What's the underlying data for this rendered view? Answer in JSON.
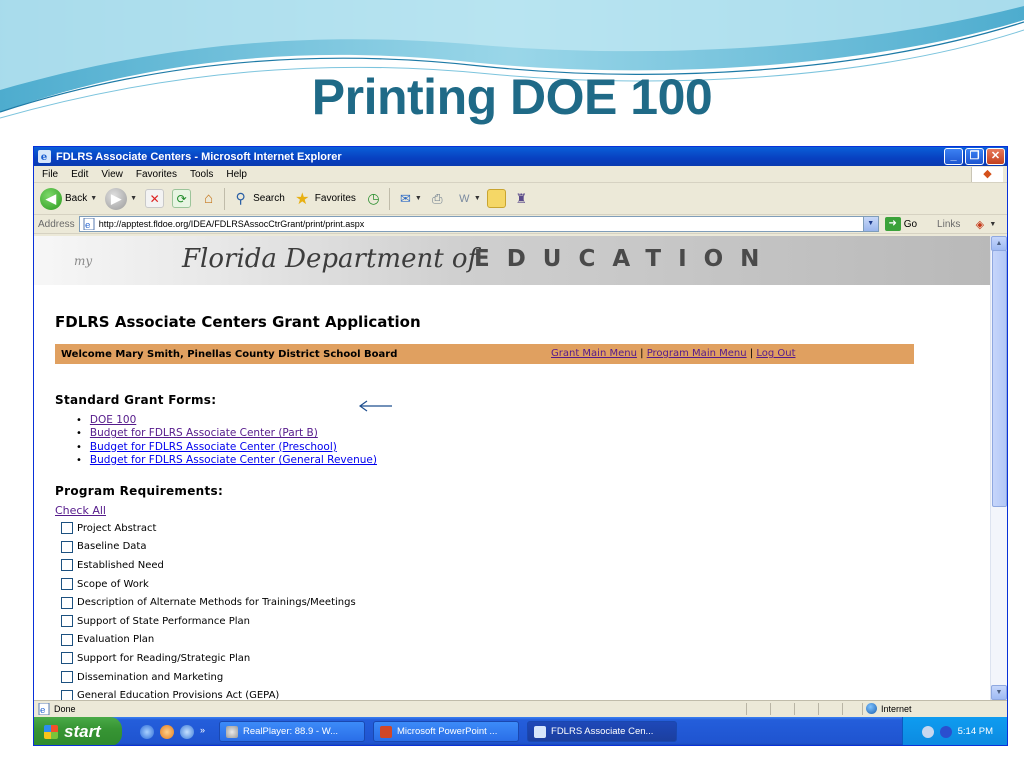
{
  "slide": {
    "title": "Printing DOE 100",
    "colors": {
      "title": "#1f6a87",
      "wave": "#5bb8d6"
    }
  },
  "window": {
    "title": "FDLRS Associate Centers - Microsoft Internet Explorer",
    "menu": [
      "File",
      "Edit",
      "View",
      "Favorites",
      "Tools",
      "Help"
    ],
    "toolbar": {
      "back_label": "Back",
      "search_label": "Search",
      "favorites_label": "Favorites"
    },
    "address": {
      "label": "Address",
      "url": "http://apptest.fldoe.org/IDEA/FDLRSAssocCtrGrant/print/print.aspx",
      "go_label": "Go",
      "links_label": "Links"
    }
  },
  "page": {
    "banner": {
      "logo_text": "my",
      "florida_text": "Florida Department of",
      "education_text": "EDUCATION"
    },
    "heading": "FDLRS Associate Centers Grant Application",
    "welcome": "Welcome Mary Smith, Pinellas County  District School Board",
    "nav": {
      "grant_main_menu": "Grant Main Menu",
      "program_main_menu": "Program Main Menu",
      "log_out": "Log Out",
      "separator": "|"
    },
    "standard_forms_heading": "Standard Grant Forms:",
    "standard_forms": [
      {
        "label": "DOE 100",
        "visited": true
      },
      {
        "label": "Budget for FDLRS Associate Center (Part B)",
        "visited": true
      },
      {
        "label": "Budget for FDLRS Associate Center (Preschool)",
        "visited": false
      },
      {
        "label": "Budget for FDLRS Associate Center (General Revenue)",
        "visited": false
      }
    ],
    "program_requirements_heading": "Program Requirements:",
    "check_all": "Check All",
    "requirements": [
      "Project Abstract",
      "Baseline Data",
      "Established Need",
      "Scope of Work",
      "Description of Alternate Methods for Trainings/Meetings",
      "Support of State Performance Plan",
      "Evaluation Plan",
      "Support for Reading/Strategic Plan",
      "Dissemination and Marketing",
      "General Education Provisions Act (GEPA)"
    ],
    "colors": {
      "welcome_bar": "#e0a060",
      "visited_link": "#551a8b",
      "link": "#0000ee"
    }
  },
  "statusbar": {
    "status": "Done",
    "zone": "Internet"
  },
  "taskbar": {
    "start_label": "start",
    "tasks": [
      {
        "label": "RealPlayer: 88.9 - W...",
        "active": false
      },
      {
        "label": "Microsoft PowerPoint ...",
        "active": false
      },
      {
        "label": "FDLRS Associate Cen...",
        "active": true
      }
    ],
    "clock": "5:14 PM"
  }
}
